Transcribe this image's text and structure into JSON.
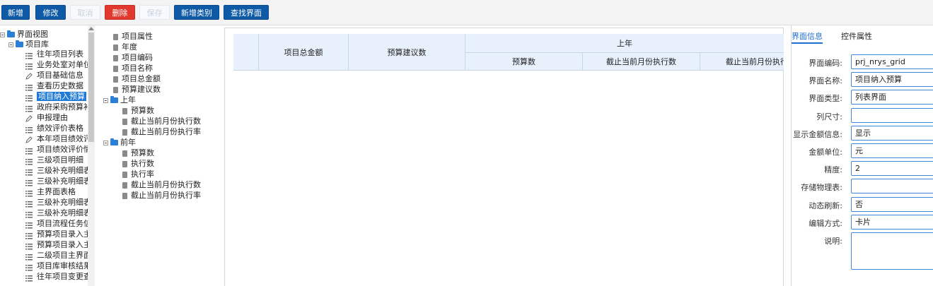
{
  "toolbar": {
    "buttons": [
      {
        "label": "新增",
        "state": "primary"
      },
      {
        "label": "修改",
        "state": "primary"
      },
      {
        "label": "取消",
        "state": "disabled"
      },
      {
        "label": "删除",
        "state": "danger"
      },
      {
        "label": "保存",
        "state": "disabled"
      },
      {
        "label": "新增类别",
        "state": "primary"
      },
      {
        "label": "查找界面",
        "state": "primary"
      }
    ]
  },
  "left_tree": {
    "root": "界面视图",
    "group": "项目库",
    "items": [
      {
        "label": "往年项目列表",
        "icon": "list-icon"
      },
      {
        "label": "业务处室对单位",
        "icon": "list-icon"
      },
      {
        "label": "项目基础信息",
        "icon": "pencil-icon"
      },
      {
        "label": "查看历史数据",
        "icon": "list-icon"
      },
      {
        "label": "项目纳入预算",
        "icon": "list-icon"
      },
      {
        "label": "政府采购预算补",
        "icon": "list-icon"
      },
      {
        "label": "申报理由",
        "icon": "pencil-icon"
      },
      {
        "label": "绩效评价表格",
        "icon": "list-icon"
      },
      {
        "label": "本年项目绩效评",
        "icon": "pencil-icon"
      },
      {
        "label": "项目绩效评价情",
        "icon": "list-icon"
      },
      {
        "label": "三级项目明细",
        "icon": "list-icon"
      },
      {
        "label": "三级补充明细表",
        "icon": "list-icon"
      },
      {
        "label": "三级补充明细表",
        "icon": "list-icon"
      },
      {
        "label": "主界面表格",
        "icon": "list-icon"
      },
      {
        "label": "三级补充明细表",
        "icon": "list-icon"
      },
      {
        "label": "三级补充明细表",
        "icon": "list-icon"
      },
      {
        "label": "项目流程任务信",
        "icon": "list-icon"
      },
      {
        "label": "预算项目录入主",
        "icon": "list-icon"
      },
      {
        "label": "预算项目录入主",
        "icon": "list-icon"
      },
      {
        "label": "二级项目主界面",
        "icon": "list-icon"
      },
      {
        "label": "项目库审核结果",
        "icon": "list-icon"
      },
      {
        "label": "往年项目变更查",
        "icon": "list-icon"
      }
    ],
    "selected_index": 4
  },
  "field_tree": {
    "top_items": [
      "项目属性",
      "年度",
      "项目编码",
      "项目名称",
      "项目总金额",
      "预算建议数"
    ],
    "groups": [
      {
        "label": "上年",
        "items": [
          "预算数",
          "截止当前月份执行数",
          "截止当前月份执行率"
        ]
      },
      {
        "label": "前年",
        "items": [
          "预算数",
          "执行数",
          "执行率",
          "截止当前月份执行数",
          "截止当前月份执行率"
        ]
      }
    ]
  },
  "grid": {
    "col_total": "项目总金额",
    "col_suggest": "预算建议数",
    "group_label": "上年",
    "sub_cols": [
      "预算数",
      "截止当前月份执行数",
      "截止当前月份执行率"
    ]
  },
  "props": {
    "tabs": [
      "界面信息",
      "控件属性"
    ],
    "fields": [
      {
        "label": "界面编码:",
        "value": "prj_nrys_grid"
      },
      {
        "label": "界面名称:",
        "value": "项目纳入预算"
      },
      {
        "label": "界面类型:",
        "value": "列表界面"
      },
      {
        "label": "列尺寸:",
        "value": ""
      },
      {
        "label": "显示金额信息:",
        "value": "显示"
      },
      {
        "label": "金额单位:",
        "value": "元"
      },
      {
        "label": "精度:",
        "value": "2"
      },
      {
        "label": "存储物理表:",
        "value": ""
      },
      {
        "label": "动态刷新:",
        "value": "否"
      },
      {
        "label": "编辑方式:",
        "value": "卡片"
      },
      {
        "label": "说明:",
        "value": ""
      }
    ]
  },
  "colors": {
    "primary": "#0f5aa6",
    "danger": "#e1392e",
    "accent": "#1f6fd1",
    "header_bg": "#e8f0fc"
  }
}
